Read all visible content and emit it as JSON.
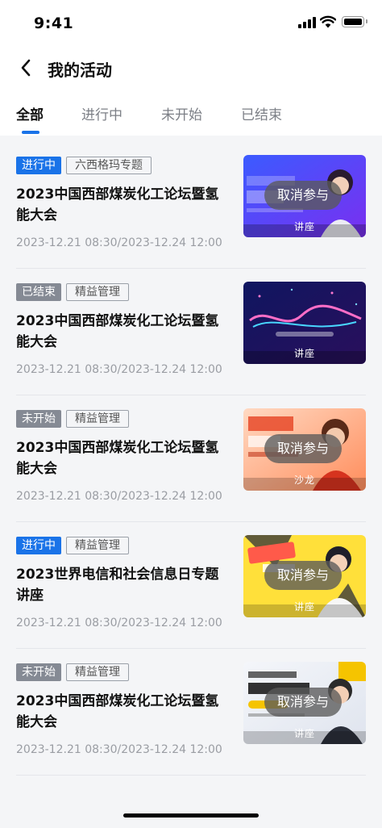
{
  "status_bar": {
    "time": "9:41"
  },
  "nav": {
    "title": "我的活动"
  },
  "tabs": [
    {
      "label": "全部"
    },
    {
      "label": "进行中"
    },
    {
      "label": "未开始"
    },
    {
      "label": "已结束"
    }
  ],
  "cancel_label": "取消参与",
  "colors": {
    "accent": "#1a73e8",
    "status_ongoing": "#1a73e8",
    "status_ended": "#858a94",
    "status_not_started": "#858a94"
  },
  "activities": [
    {
      "status": "进行中",
      "category": "六西格玛专题",
      "title": "2023中国西部煤炭化工论坛暨氢能大会",
      "date": "2023-12.21 08:30/2023-12.24 12:00",
      "type": "讲座"
    },
    {
      "status": "已结束",
      "category": "精益管理",
      "title": "2023中国西部煤炭化工论坛暨氢能大会",
      "date": "2023-12.21 08:30/2023-12.24 12:00",
      "type": "讲座"
    },
    {
      "status": "未开始",
      "category": "精益管理",
      "title": "2023中国西部煤炭化工论坛暨氢能大会",
      "date": "2023-12.21 08:30/2023-12.24 12:00",
      "type": "沙龙"
    },
    {
      "status": "进行中",
      "category": "精益管理",
      "title": "2023世界电信和社会信息日专题讲座",
      "date": "2023-12.21 08:30/2023-12.24 12:00",
      "type": "讲座"
    },
    {
      "status": "未开始",
      "category": "精益管理",
      "title": "2023中国西部煤炭化工论坛暨氢能大会",
      "date": "2023-12.21 08:30/2023-12.24 12:00",
      "type": "讲座"
    }
  ]
}
